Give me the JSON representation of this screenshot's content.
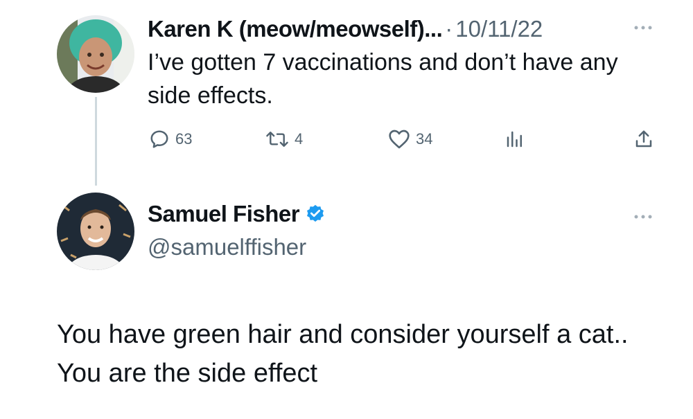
{
  "tweet1": {
    "author_name": "Karen K (meow/meowself)...",
    "separator": "·",
    "date": "10/11/22",
    "text": "I’ve gotten 7 vaccinations and don’t have any side effects.",
    "more_icon": "ellipsis-icon",
    "actions": {
      "reply_count": "63",
      "retweet_count": "4",
      "like_count": "34",
      "reply_icon": "reply-icon",
      "retweet_icon": "retweet-icon",
      "like_icon": "heart-icon",
      "views_icon": "views-icon",
      "share_icon": "share-icon"
    }
  },
  "tweet2": {
    "author_name": "Samuel Fisher",
    "verified_icon": "verified-badge-icon",
    "handle": "@samuelffisher",
    "text": "You have green hair and consider yourself a cat.. You are the side effect",
    "more_icon": "ellipsis-icon"
  },
  "colors": {
    "text_primary": "#0f1419",
    "text_secondary": "#536471",
    "verified_blue": "#1d9bf0",
    "thread_line": "#cfd9de"
  }
}
